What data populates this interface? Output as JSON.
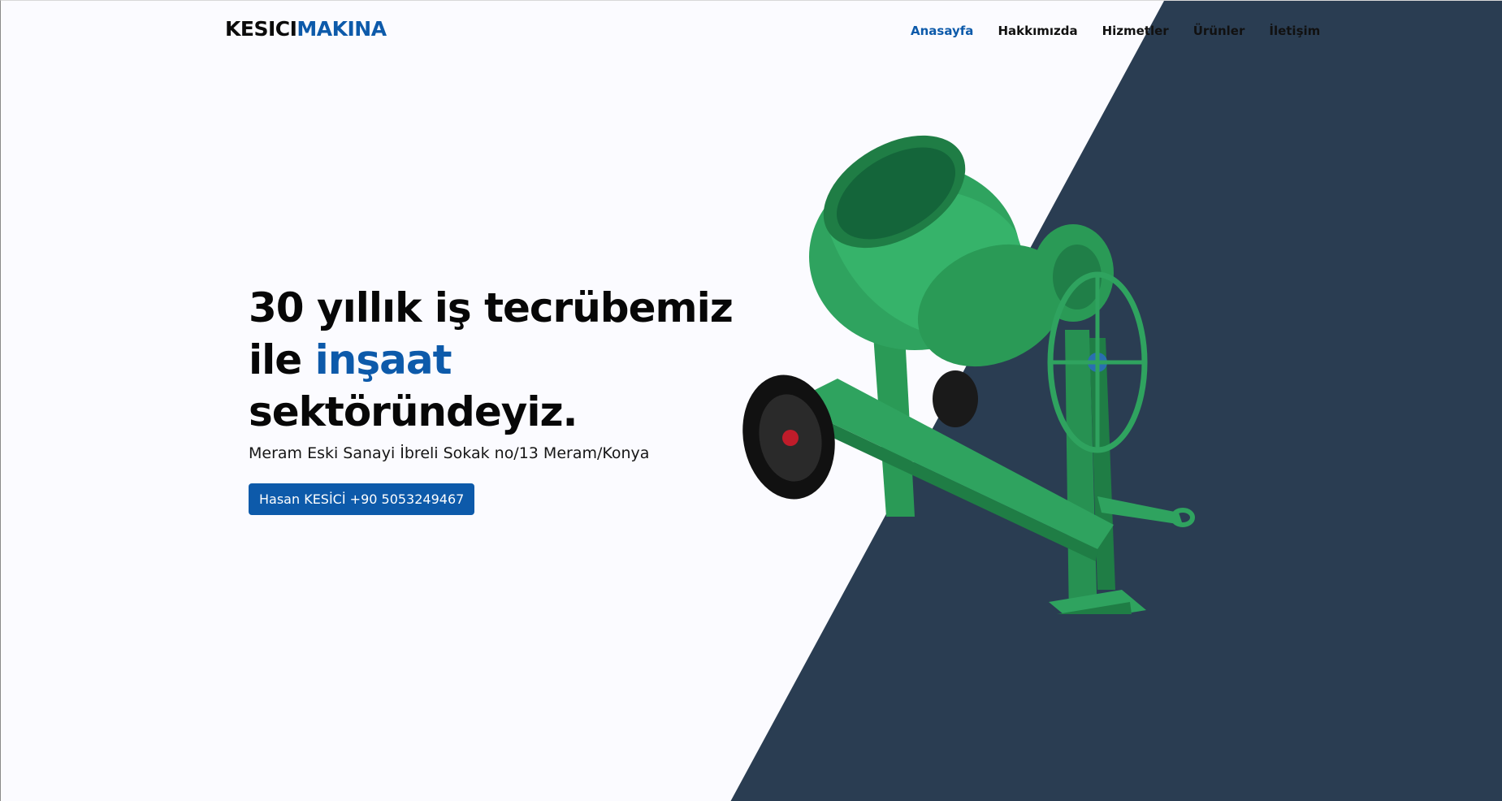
{
  "brand": {
    "name_part1": "KESICI",
    "name_part2": "MAKINA",
    "accent_color": "#0d5aaa"
  },
  "nav": {
    "items": [
      {
        "label": "Anasayfa",
        "active": true
      },
      {
        "label": "Hakkımızda",
        "active": false
      },
      {
        "label": "Hizmetler",
        "active": false
      },
      {
        "label": "Ürünler",
        "active": false
      },
      {
        "label": "İletişim",
        "active": false
      }
    ]
  },
  "hero": {
    "title_line1": "30 yıllık iş tecrübemiz",
    "title_line2_prefix": "ile ",
    "title_line2_accent": "inşaat",
    "title_line3": "sektöründeyiz.",
    "address": "Meram Eski Sanayi İbreli Sokak no/13 Meram/Konya",
    "cta_label": "Hasan KESİCİ +90 5053249467"
  },
  "colors": {
    "background": "#fbfbff",
    "dark_panel": "#2a3d52",
    "mixer_green": "#2fa35f"
  }
}
